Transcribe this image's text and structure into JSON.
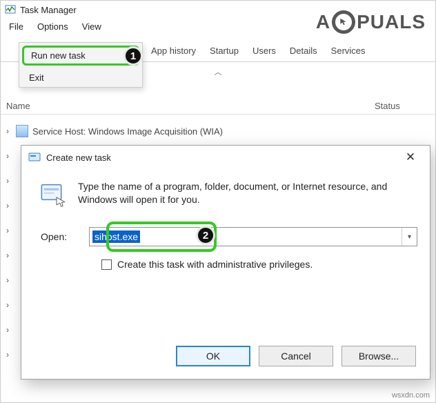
{
  "window": {
    "title": "Task Manager"
  },
  "menubar": {
    "file": "File",
    "options": "Options",
    "view": "View"
  },
  "file_menu": {
    "run": "Run new task",
    "exit": "Exit"
  },
  "tabs": {
    "history": "App history",
    "startup": "Startup",
    "users": "Users",
    "details": "Details",
    "services": "Services"
  },
  "columns": {
    "name": "Name",
    "status": "Status"
  },
  "first_row": "Service Host: Windows Image Acquisition (WIA)",
  "dialog": {
    "title": "Create new task",
    "message": "Type the name of a program, folder, document, or Internet resource, and Windows will open it for you.",
    "open_label": "Open:",
    "open_value": "sihost.exe",
    "admin_label": "Create this task with administrative privileges.",
    "ok": "OK",
    "cancel": "Cancel",
    "browse": "Browse..."
  },
  "badges": {
    "one": "1",
    "two": "2"
  },
  "watermark": {
    "a": "A",
    "puals": "PUALS",
    "footer": "wsxdn.com"
  }
}
